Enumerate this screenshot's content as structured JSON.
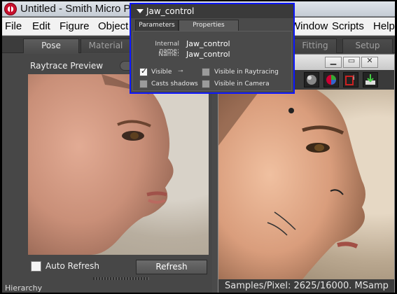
{
  "window": {
    "title": "Untitled - Smith Micro P"
  },
  "menubar": {
    "items": [
      "File",
      "Edit",
      "Figure",
      "Object",
      "Window",
      "Scripts",
      "Help"
    ]
  },
  "tabs": {
    "pose": "Pose",
    "material": "Material",
    "fitting": "Fitting",
    "setup": "Setup"
  },
  "preview": {
    "label": "Raytrace Preview",
    "auto_refresh_label": "Auto Refresh",
    "auto_refresh_checked": false,
    "refresh_button": "Refresh",
    "hierarchy_label": "Hierarchy"
  },
  "render_window": {
    "status_text": "Samples/Pixel: 2625/16000. MSamp"
  },
  "properties_dialog": {
    "title": "Jaw_control",
    "tabs": [
      "Parameters",
      "Properties"
    ],
    "active_tab": "Properties",
    "internal_name_label": "Internal name:",
    "internal_name_value": "Jaw_control",
    "name_label": "Name:",
    "name_value": "Jaw_control",
    "checkboxes": {
      "visible": {
        "label": "Visible",
        "checked": true
      },
      "visible_in_raytracing": {
        "label": "Visible in Raytracing",
        "checked": false
      },
      "casts_shadows": {
        "label": "Casts shadows",
        "checked": false
      },
      "visible_in_camera": {
        "label": "Visible in Camera",
        "checked": false
      }
    },
    "border_color": "#0b16ff"
  },
  "colors": {
    "panel_bg": "#4a4a4a",
    "menubar_bg": "#f2f2f2"
  }
}
